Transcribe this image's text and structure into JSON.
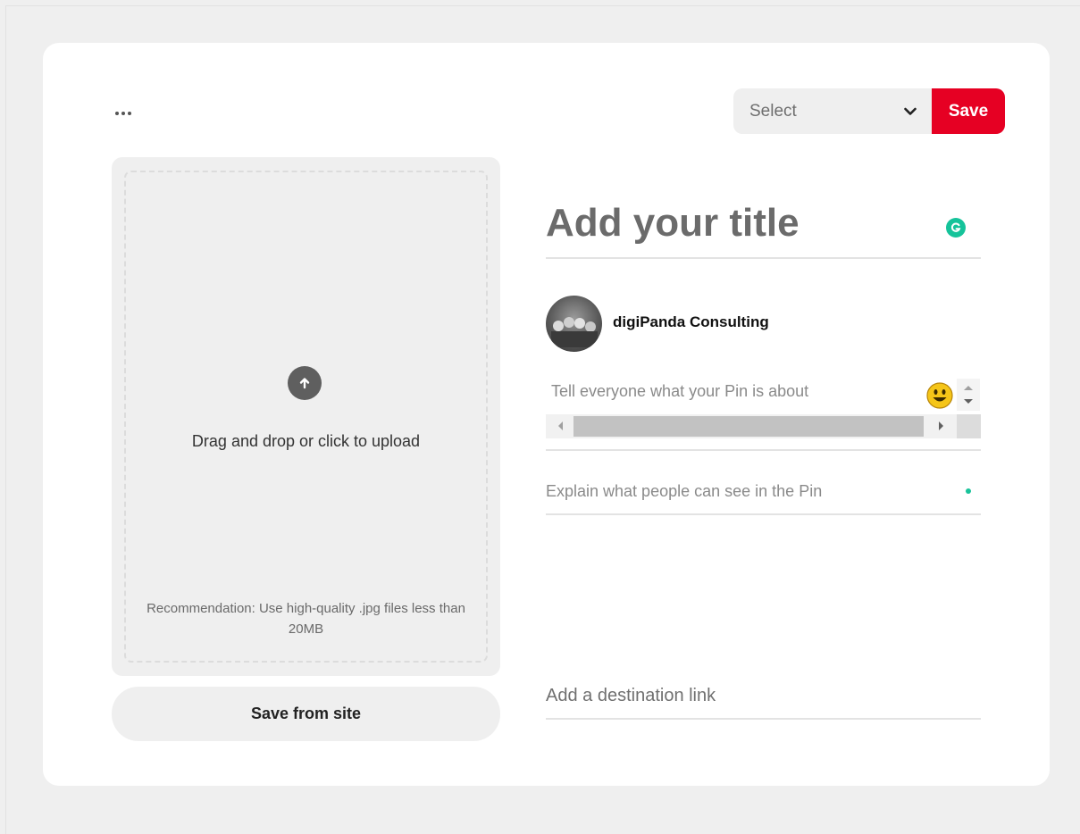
{
  "header": {
    "more_icon": "ellipsis-icon",
    "board_select": {
      "selected": "Select",
      "icon": "chevron-down-icon"
    },
    "save_label": "Save"
  },
  "upload": {
    "icon": "upload-arrow-icon",
    "prompt": "Drag and drop or click to upload",
    "recommendation": "Recommendation: Use high-quality .jpg files less than 20MB"
  },
  "save_from_site_label": "Save from site",
  "pin": {
    "title_placeholder": "Add your title",
    "grammarly_icon": "grammarly-icon",
    "user_name": "digiPanda Consulting",
    "about_placeholder": "Tell everyone what your Pin is about",
    "emoji_icon": "smiley-emoji-icon",
    "alt_text_placeholder": "Explain what people can see in the Pin",
    "destination_placeholder": "Add a destination link"
  },
  "colors": {
    "save_red": "#e60023",
    "grammarly_green": "#15c39a"
  }
}
